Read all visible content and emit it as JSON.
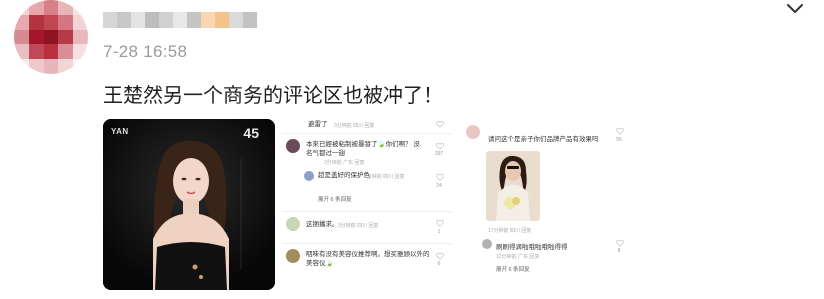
{
  "post": {
    "timestamp": "7-28 16:58",
    "text": "王楚然另一个商务的评论区也被冲了！"
  },
  "image1": {
    "brand": "YAN",
    "number": "45"
  },
  "image2": {
    "comments": [
      {
        "text": "避雷了",
        "meta": "3分钟前 四川 回复",
        "count": "",
        "more": ""
      },
      {
        "text": "本來已經被粘制被暴發了🍃你们啊？ 没名气都过一翅",
        "meta": "3分钟前 广东 回复",
        "count": "397",
        "more": ""
      },
      {
        "text": "超是盖好的保护色",
        "meta": "1分钟前 四川 回复",
        "count": "24",
        "more": "展开 6 条回复"
      },
      {
        "text": "这捆播求。",
        "meta": "3分钟前 四川 回复",
        "count": "1",
        "more": ""
      },
      {
        "text": "咽味有没有美容仪推荐啊。想买雅顾以外的美容仪🍃",
        "meta": "",
        "count": "6",
        "more": ""
      }
    ]
  },
  "image3": {
    "comments": [
      {
        "text": "请问这个是亲子你们品牌产品有效果吗",
        "meta": "17分钟前 四川 回复",
        "count": "55",
        "more": ""
      },
      {
        "text": "刷刷得滴啦哦啦哦啦得得",
        "meta": "12分钟前 广东 回复",
        "count": "8",
        "more": "展开 6 条回复"
      }
    ]
  },
  "colors": {
    "timestamp": "#9a9a9a",
    "text": "#1f1f1f"
  },
  "icons": {
    "chevron": "chevron-down-icon",
    "heart": "heart-icon"
  }
}
